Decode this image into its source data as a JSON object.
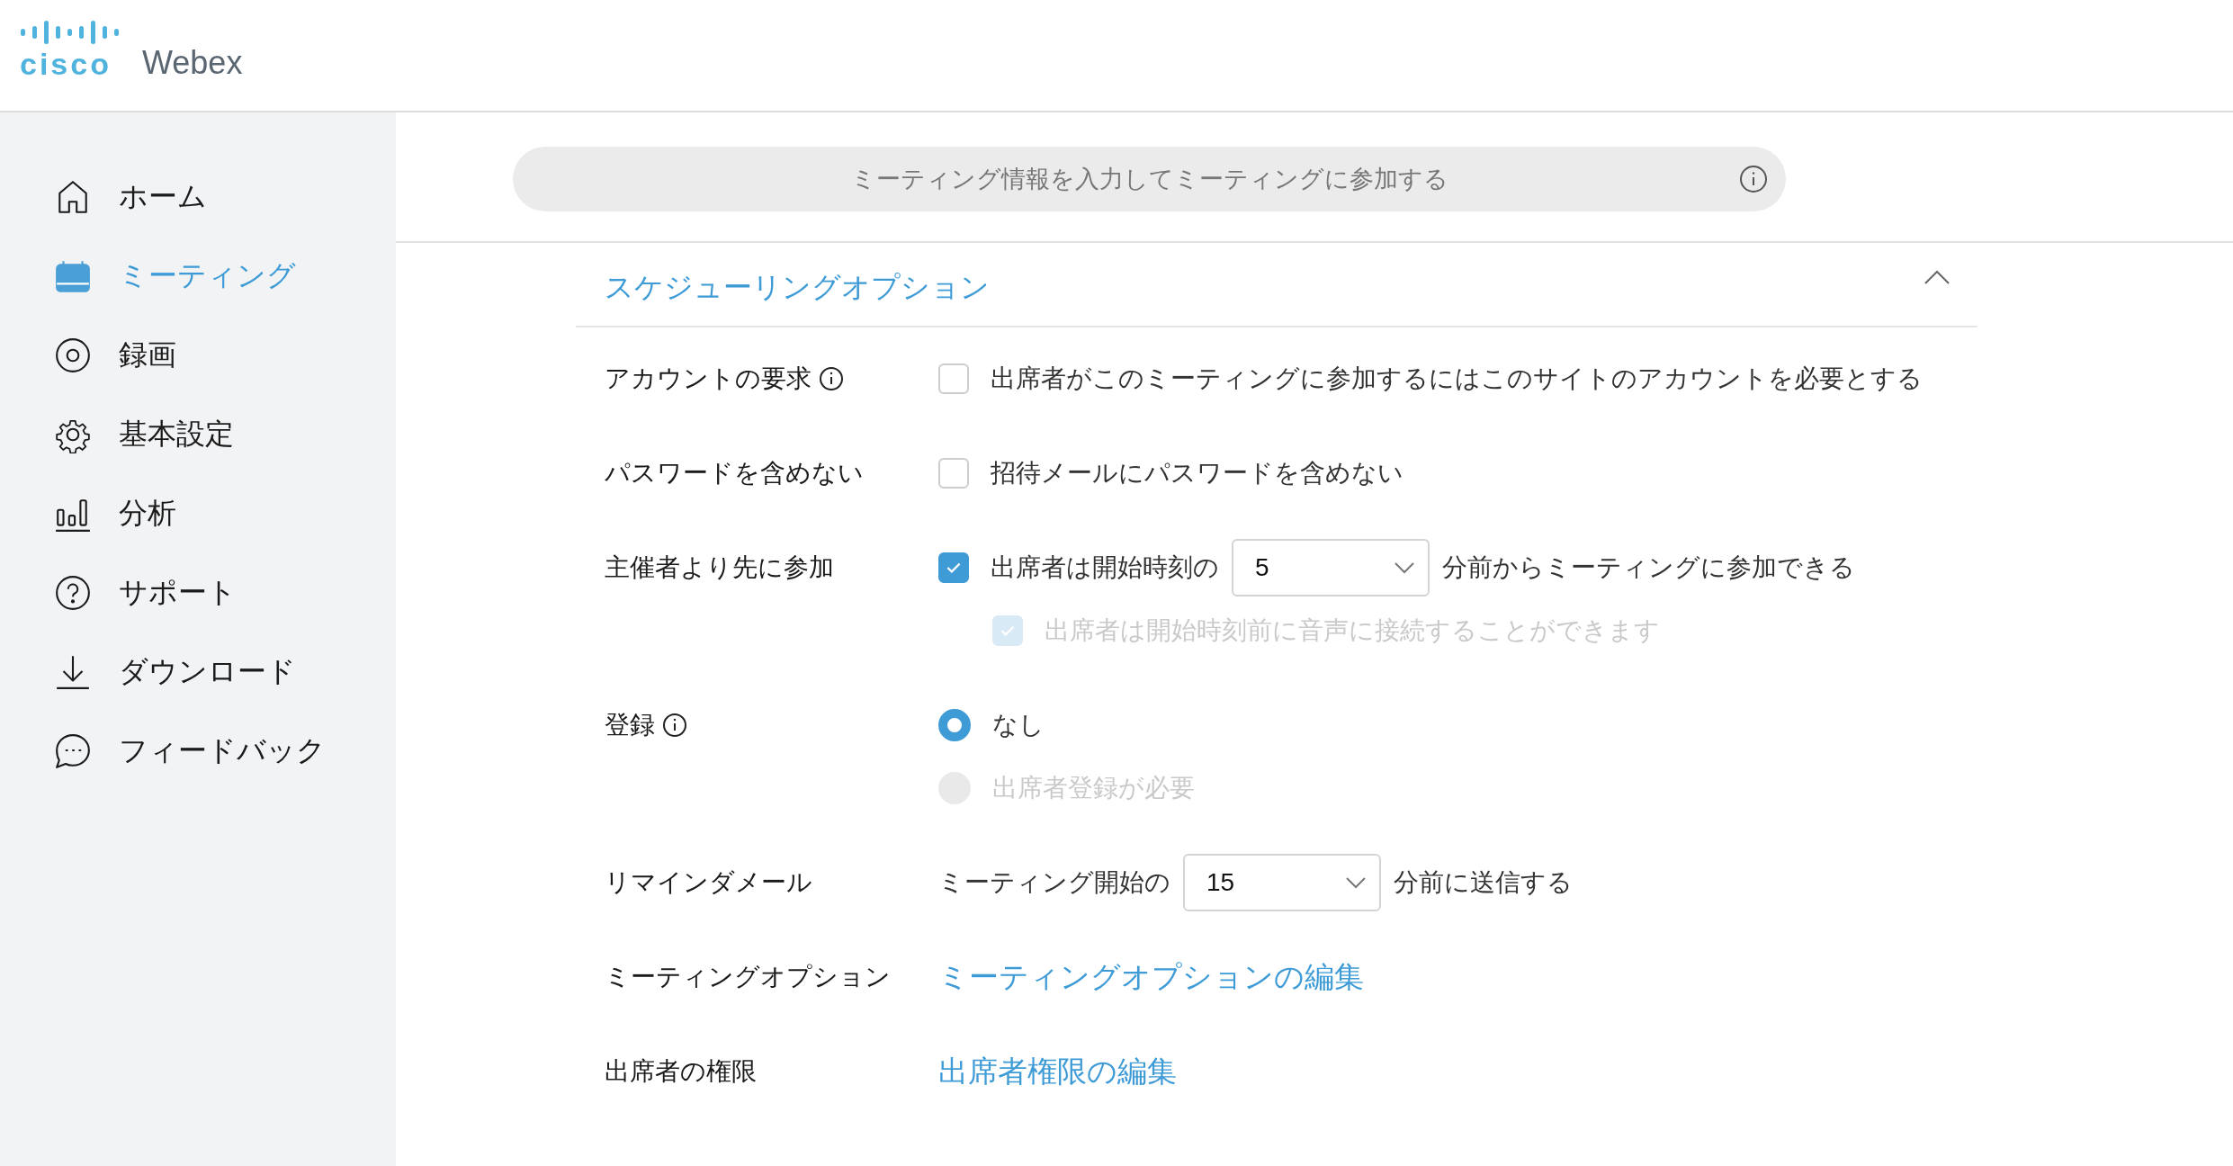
{
  "header": {
    "logo": {
      "brand": "cisco",
      "product": "Webex"
    }
  },
  "sidebar": {
    "items": [
      {
        "kind": "home",
        "label": "ホーム",
        "selected": false
      },
      {
        "kind": "calendar",
        "label": "ミーティング",
        "selected": true
      },
      {
        "kind": "record",
        "label": "録画",
        "selected": false
      },
      {
        "kind": "gear",
        "label": "基本設定",
        "selected": false
      },
      {
        "kind": "chart",
        "label": "分析",
        "selected": false
      },
      {
        "kind": "help",
        "label": "サポート",
        "selected": false
      },
      {
        "kind": "download",
        "label": "ダウンロード",
        "selected": false
      },
      {
        "kind": "chat",
        "label": "フィードバック",
        "selected": false
      }
    ]
  },
  "search": {
    "placeholder": "ミーティング情報を入力してミーティングに参加する"
  },
  "section": {
    "title": "スケジューリングオプション",
    "expanded": true,
    "rows": [
      {
        "label": "アカウントの要求",
        "info": true,
        "lines": [
          {
            "kind": "checkbox",
            "checked": false,
            "disabled": false,
            "parts": [
              {
                "kind": "text",
                "text": "出席者がこのミーティングに参加するにはこのサイトのアカウントを必要とする"
              }
            ]
          }
        ]
      },
      {
        "label": "パスワードを含めない",
        "info": false,
        "lines": [
          {
            "kind": "checkbox",
            "checked": false,
            "disabled": false,
            "parts": [
              {
                "kind": "text",
                "text": "招待メールにパスワードを含めない"
              }
            ]
          }
        ]
      },
      {
        "label": "主催者より先に参加",
        "info": false,
        "lines": [
          {
            "kind": "checkbox",
            "checked": true,
            "disabled": false,
            "parts": [
              {
                "kind": "text",
                "text": "出席者は開始時刻の"
              },
              {
                "kind": "select",
                "value": "5"
              },
              {
                "kind": "text",
                "text": "分前からミーティングに参加できる"
              }
            ],
            "children": [
              {
                "kind": "checkbox",
                "checked": true,
                "disabled": true,
                "parts": [
                  {
                    "kind": "text",
                    "text": "出席者は開始時刻前に音声に接続することができます"
                  }
                ]
              }
            ]
          }
        ]
      },
      {
        "label": "登録",
        "info": true,
        "lines": [
          {
            "kind": "radio",
            "selected": true,
            "disabled": false,
            "parts": [
              {
                "kind": "text",
                "text": "なし"
              }
            ]
          },
          {
            "kind": "radio",
            "selected": false,
            "disabled": true,
            "parts": [
              {
                "kind": "text",
                "text": "出席者登録が必要"
              }
            ]
          }
        ]
      },
      {
        "label": "リマインダメール",
        "info": false,
        "lines": [
          {
            "kind": "plain",
            "parts": [
              {
                "kind": "text",
                "text": "ミーティング開始の"
              },
              {
                "kind": "select",
                "value": "15"
              },
              {
                "kind": "text",
                "text": "分前に送信する"
              }
            ]
          }
        ]
      },
      {
        "label": "ミーティングオプション",
        "info": false,
        "lines": [
          {
            "kind": "plain",
            "parts": [
              {
                "kind": "link",
                "text": "ミーティングオプションの編集"
              }
            ]
          }
        ]
      },
      {
        "label": "出席者の権限",
        "info": false,
        "lines": [
          {
            "kind": "plain",
            "parts": [
              {
                "kind": "link",
                "text": "出席者権限の編集"
              }
            ]
          }
        ]
      }
    ]
  }
}
